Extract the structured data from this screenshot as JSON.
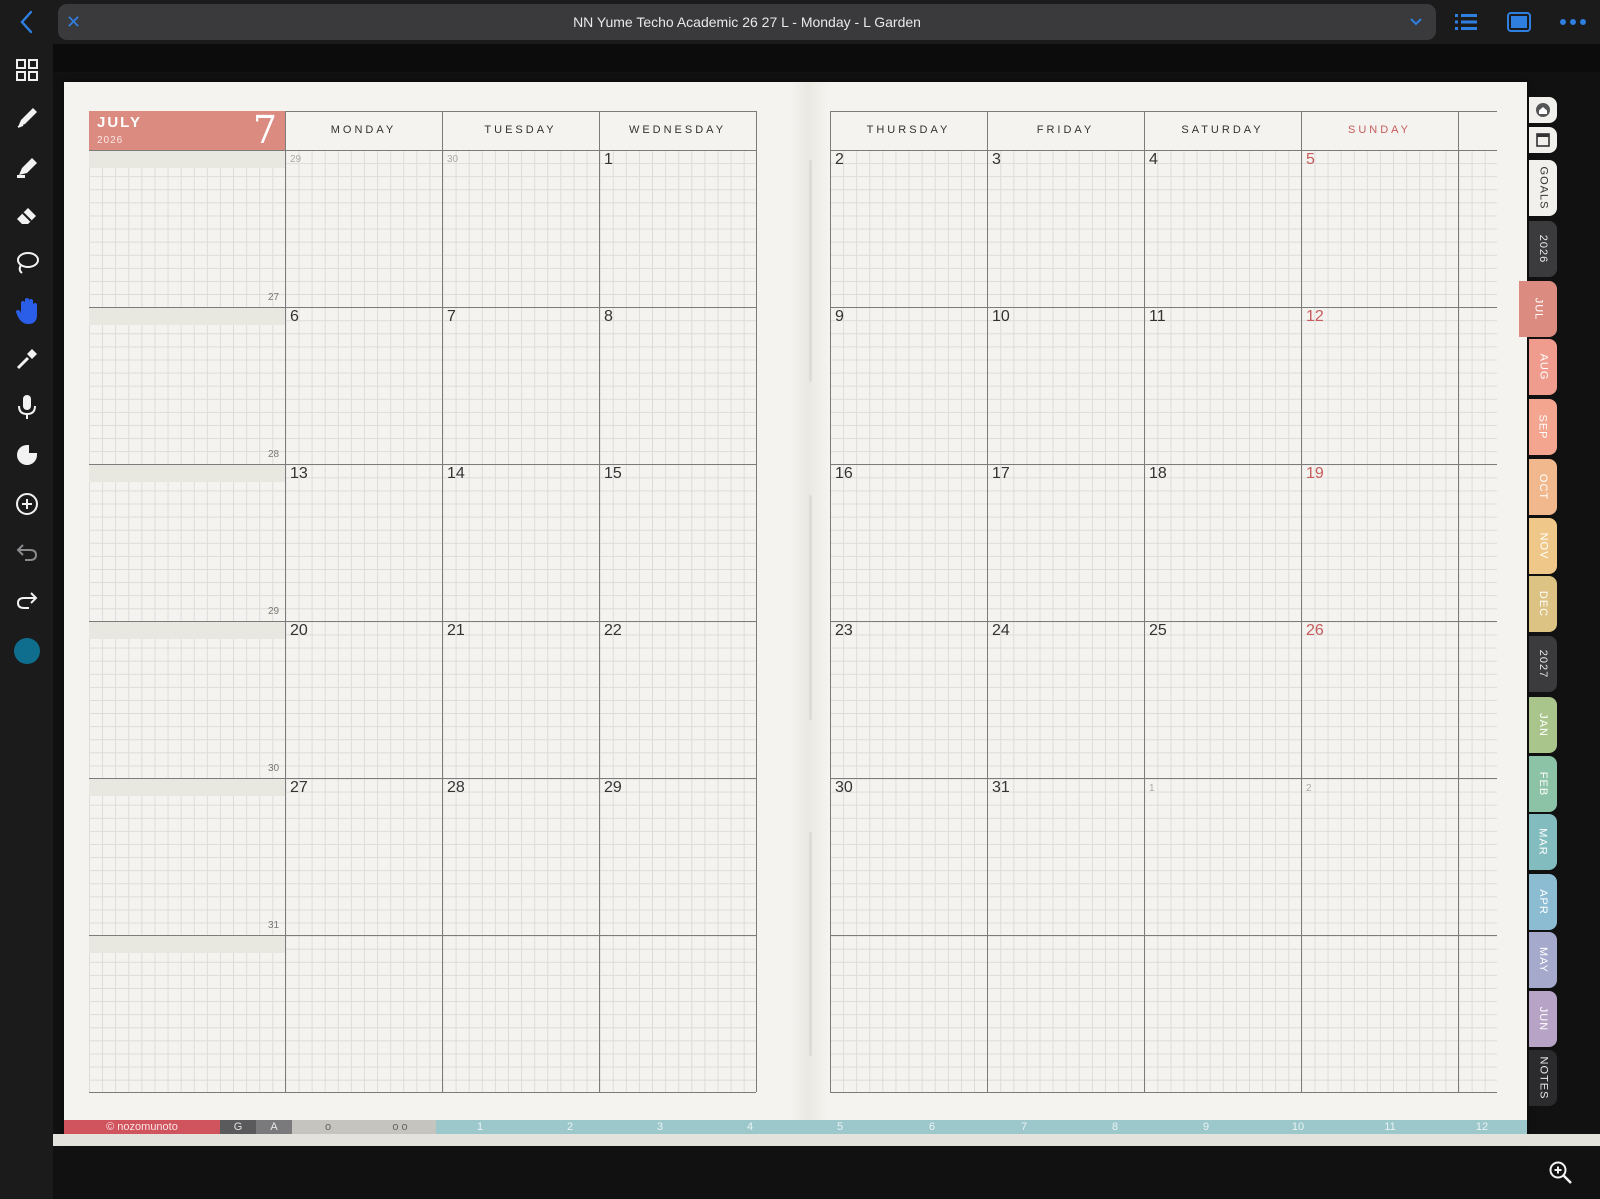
{
  "window": {
    "title": "NN Yume Techo Academic 26 27 L - Monday - L Garden"
  },
  "toolbar_icons": [
    "back-chevron-icon",
    "close-icon",
    "chevron-down-icon",
    "list-icon",
    "page-view-icon",
    "more-icon"
  ],
  "left_tools": [
    "thumbnails-icon",
    "pen-icon",
    "highlighter-icon",
    "eraser-icon",
    "lasso-icon",
    "hand-icon",
    "eyedropper-icon",
    "microphone-icon",
    "sticker-icon",
    "add-icon",
    "undo-icon",
    "redo-icon",
    "color-dot-icon"
  ],
  "colors": {
    "accent": "#2f7fe0",
    "month_header": "#db8b80",
    "sunday": "#c65c5c",
    "current_color": "#0f6e8e"
  },
  "calendar": {
    "month": "JULY",
    "year": "2026",
    "month_number": "7",
    "left_days": [
      "MONDAY",
      "TUESDAY",
      "WEDNESDAY"
    ],
    "right_days": [
      "THURSDAY",
      "FRIDAY",
      "SATURDAY",
      "SUNDAY"
    ],
    "week_numbers": [
      "27",
      "28",
      "29",
      "30",
      "31"
    ],
    "left_weeks": [
      [
        "29",
        "30",
        "1"
      ],
      [
        "6",
        "7",
        "8"
      ],
      [
        "13",
        "14",
        "15"
      ],
      [
        "20",
        "21",
        "22"
      ],
      [
        "27",
        "28",
        "29"
      ]
    ],
    "right_weeks": [
      [
        "2",
        "3",
        "4",
        "5"
      ],
      [
        "9",
        "10",
        "11",
        "12"
      ],
      [
        "16",
        "17",
        "18",
        "19"
      ],
      [
        "23",
        "24",
        "25",
        "26"
      ],
      [
        "30",
        "31",
        "1",
        "2"
      ]
    ]
  },
  "side_tabs": [
    {
      "label": "GOALS",
      "color": "#f1f0ec",
      "text": "#333333"
    },
    {
      "label": "2026",
      "color": "#3b3b3d",
      "text": "#e8e8e8"
    },
    {
      "label": "JUL",
      "color": "#db8b80",
      "text": "#ffffff"
    },
    {
      "label": "AUG",
      "color": "#ef9c8e",
      "text": "#ffffff"
    },
    {
      "label": "SEP",
      "color": "#f3a58f",
      "text": "#ffffff"
    },
    {
      "label": "OCT",
      "color": "#f1b88e",
      "text": "#ffffff"
    },
    {
      "label": "NOV",
      "color": "#efc889",
      "text": "#ffffff"
    },
    {
      "label": "DEC",
      "color": "#dcc383",
      "text": "#ffffff"
    },
    {
      "label": "2027",
      "color": "#3b3b3d",
      "text": "#e8e8e8"
    },
    {
      "label": "JAN",
      "color": "#a9c58b",
      "text": "#ffffff"
    },
    {
      "label": "FEB",
      "color": "#8cc3a7",
      "text": "#ffffff"
    },
    {
      "label": "MAR",
      "color": "#83bcbf",
      "text": "#ffffff"
    },
    {
      "label": "APR",
      "color": "#8cbcd2",
      "text": "#ffffff"
    },
    {
      "label": "MAY",
      "color": "#a5a9cb",
      "text": "#ffffff"
    },
    {
      "label": "JUN",
      "color": "#b7a3c6",
      "text": "#ffffff"
    },
    {
      "label": "NOTES",
      "color": "#2b2b2d",
      "text": "#e8e8e8"
    }
  ],
  "bottom_bar": {
    "brand": "© nozomunoto",
    "letters": [
      "G",
      "A"
    ],
    "circles": [
      "o",
      "o o"
    ],
    "months": [
      "1",
      "2",
      "3",
      "4",
      "5",
      "6",
      "7",
      "8",
      "9",
      "10",
      "11",
      "12"
    ]
  }
}
